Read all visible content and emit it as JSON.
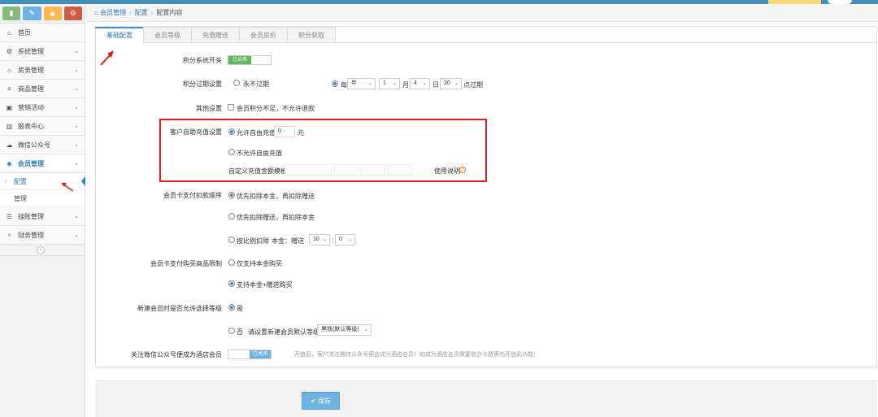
{
  "sidebar": {
    "shortcut_icons": [
      "signal-icon",
      "pencil-icon",
      "users-icon",
      "cogs-icon"
    ],
    "shortcut_colors": [
      "#87b87f",
      "#6fb3e0",
      "#ffb752",
      "#d15b47"
    ],
    "items": [
      {
        "label": "首页",
        "icon": "home-icon"
      },
      {
        "label": "系统管理",
        "icon": "gear-icon"
      },
      {
        "label": "房务管理",
        "icon": "bank-icon"
      },
      {
        "label": "商品管理",
        "icon": "database-icon"
      },
      {
        "label": "营销活动",
        "icon": "gift-icon"
      },
      {
        "label": "报表中心",
        "icon": "bar-chart-icon"
      },
      {
        "label": "微信公众号",
        "icon": "cloud-icon"
      },
      {
        "label": "会员管理",
        "icon": "group-icon"
      }
    ],
    "sub_items": [
      {
        "label": "配置"
      },
      {
        "label": "管理"
      }
    ],
    "items_after": [
      {
        "label": "挂账管理",
        "icon": "list-icon"
      },
      {
        "label": "财务管理",
        "icon": "cutlery-icon"
      }
    ]
  },
  "breadcrumb": {
    "home": "会员管理",
    "parent": "配置",
    "current": "配置内容"
  },
  "tabs": [
    "基础配置",
    "会员等级",
    "充值赠送",
    "会员房价",
    "积分获取"
  ],
  "form": {
    "points_switch": {
      "label": "积分系统开关",
      "state": "已启用"
    },
    "points_expiry": {
      "label": "积分过期设置",
      "never": "永不过期",
      "each": "每",
      "unit1": "年",
      "num1": "1",
      "month": "月",
      "num2": "4",
      "day": "日",
      "num3": "20",
      "suffix": "点过期"
    },
    "other": {
      "label": "其他设置",
      "option": "会员积分不足，不允许退款"
    },
    "self_recharge": {
      "label": "客户自助充值设置",
      "allow": "允许自由充值",
      "amount": "0",
      "unit": "元",
      "deny": "不允许自由充值",
      "template": "自定义充值金额模板",
      "help": "使用说明"
    },
    "card_pay_order": {
      "label": "会员卡支付扣款顺序",
      "opt1": "优先扣除本金，再扣除赠送",
      "opt2": "优先扣除赠送，再扣除本金",
      "opt3": "按比例扣除",
      "ratio_label": "本金：赠送",
      "ratio_a": "10",
      "ratio_sep": ":",
      "ratio_b": "0"
    },
    "card_pay_limit": {
      "label": "会员卡支付购买商品限制",
      "opt1": "仅支持本金购买",
      "opt2": "支持本金+赠送购买"
    },
    "new_member_level": {
      "label": "新建会员时是否允许选择等级",
      "yes": "是",
      "no": "否",
      "default_label": "请设置新建会员默认等级",
      "default_value": "黑铁(默认等级)"
    },
    "follow_wechat": {
      "label": "关注微信公众号便成为酒店会员",
      "state": "已关闭",
      "hint": "开启后，客户关注微信公众号便会成为酒店会员！如成为酒店会员需要收办卡费等勿开启此功能！"
    }
  },
  "actions": {
    "save": "保存"
  },
  "colors": {
    "accent": "#438eb9",
    "highlight": "#e01c1c",
    "enabled": "#5cb85c"
  }
}
